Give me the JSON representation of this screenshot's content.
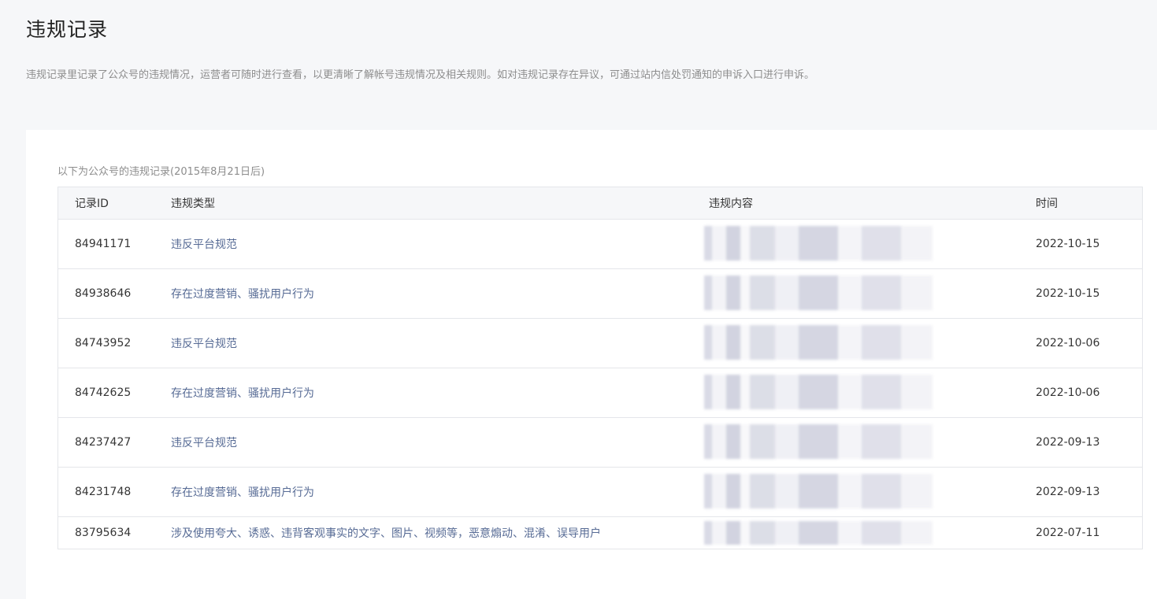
{
  "page": {
    "title": "违规记录",
    "description": "违规记录里记录了公众号的违规情况，运营者可随时进行查看，以更清晰了解帐号违规情况及相关规则。如对违规记录存在异议，可通过站内信处罚通知的申诉入口进行申诉。"
  },
  "section": {
    "caption": "以下为公众号的违规记录(2015年8月21日后)"
  },
  "table": {
    "headers": {
      "id": "记录ID",
      "type": "违规类型",
      "content": "违规内容",
      "time": "时间"
    },
    "rows": [
      {
        "id": "84941171",
        "type": "违反平台规范",
        "time": "2022-10-15"
      },
      {
        "id": "84938646",
        "type": "存在过度营销、骚扰用户行为",
        "time": "2022-10-15"
      },
      {
        "id": "84743952",
        "type": "违反平台规范",
        "time": "2022-10-06"
      },
      {
        "id": "84742625",
        "type": "存在过度营销、骚扰用户行为",
        "time": "2022-10-06"
      },
      {
        "id": "84237427",
        "type": "违反平台规范",
        "time": "2022-09-13"
      },
      {
        "id": "84231748",
        "type": "存在过度营销、骚扰用户行为",
        "time": "2022-09-13"
      },
      {
        "id": "83795634",
        "type": "涉及使用夸大、诱惑、违背客观事实的文字、图片、视频等，恶意煽动、混淆、误导用户",
        "time": "2022-07-11"
      }
    ]
  },
  "colors": {
    "page_background": "#f6f7f9",
    "card_background": "#ffffff",
    "header_row_background": "#f6f7f9",
    "border": "#e4e6ea",
    "muted_text": "#8d8d8d",
    "link_text": "#576b95"
  }
}
